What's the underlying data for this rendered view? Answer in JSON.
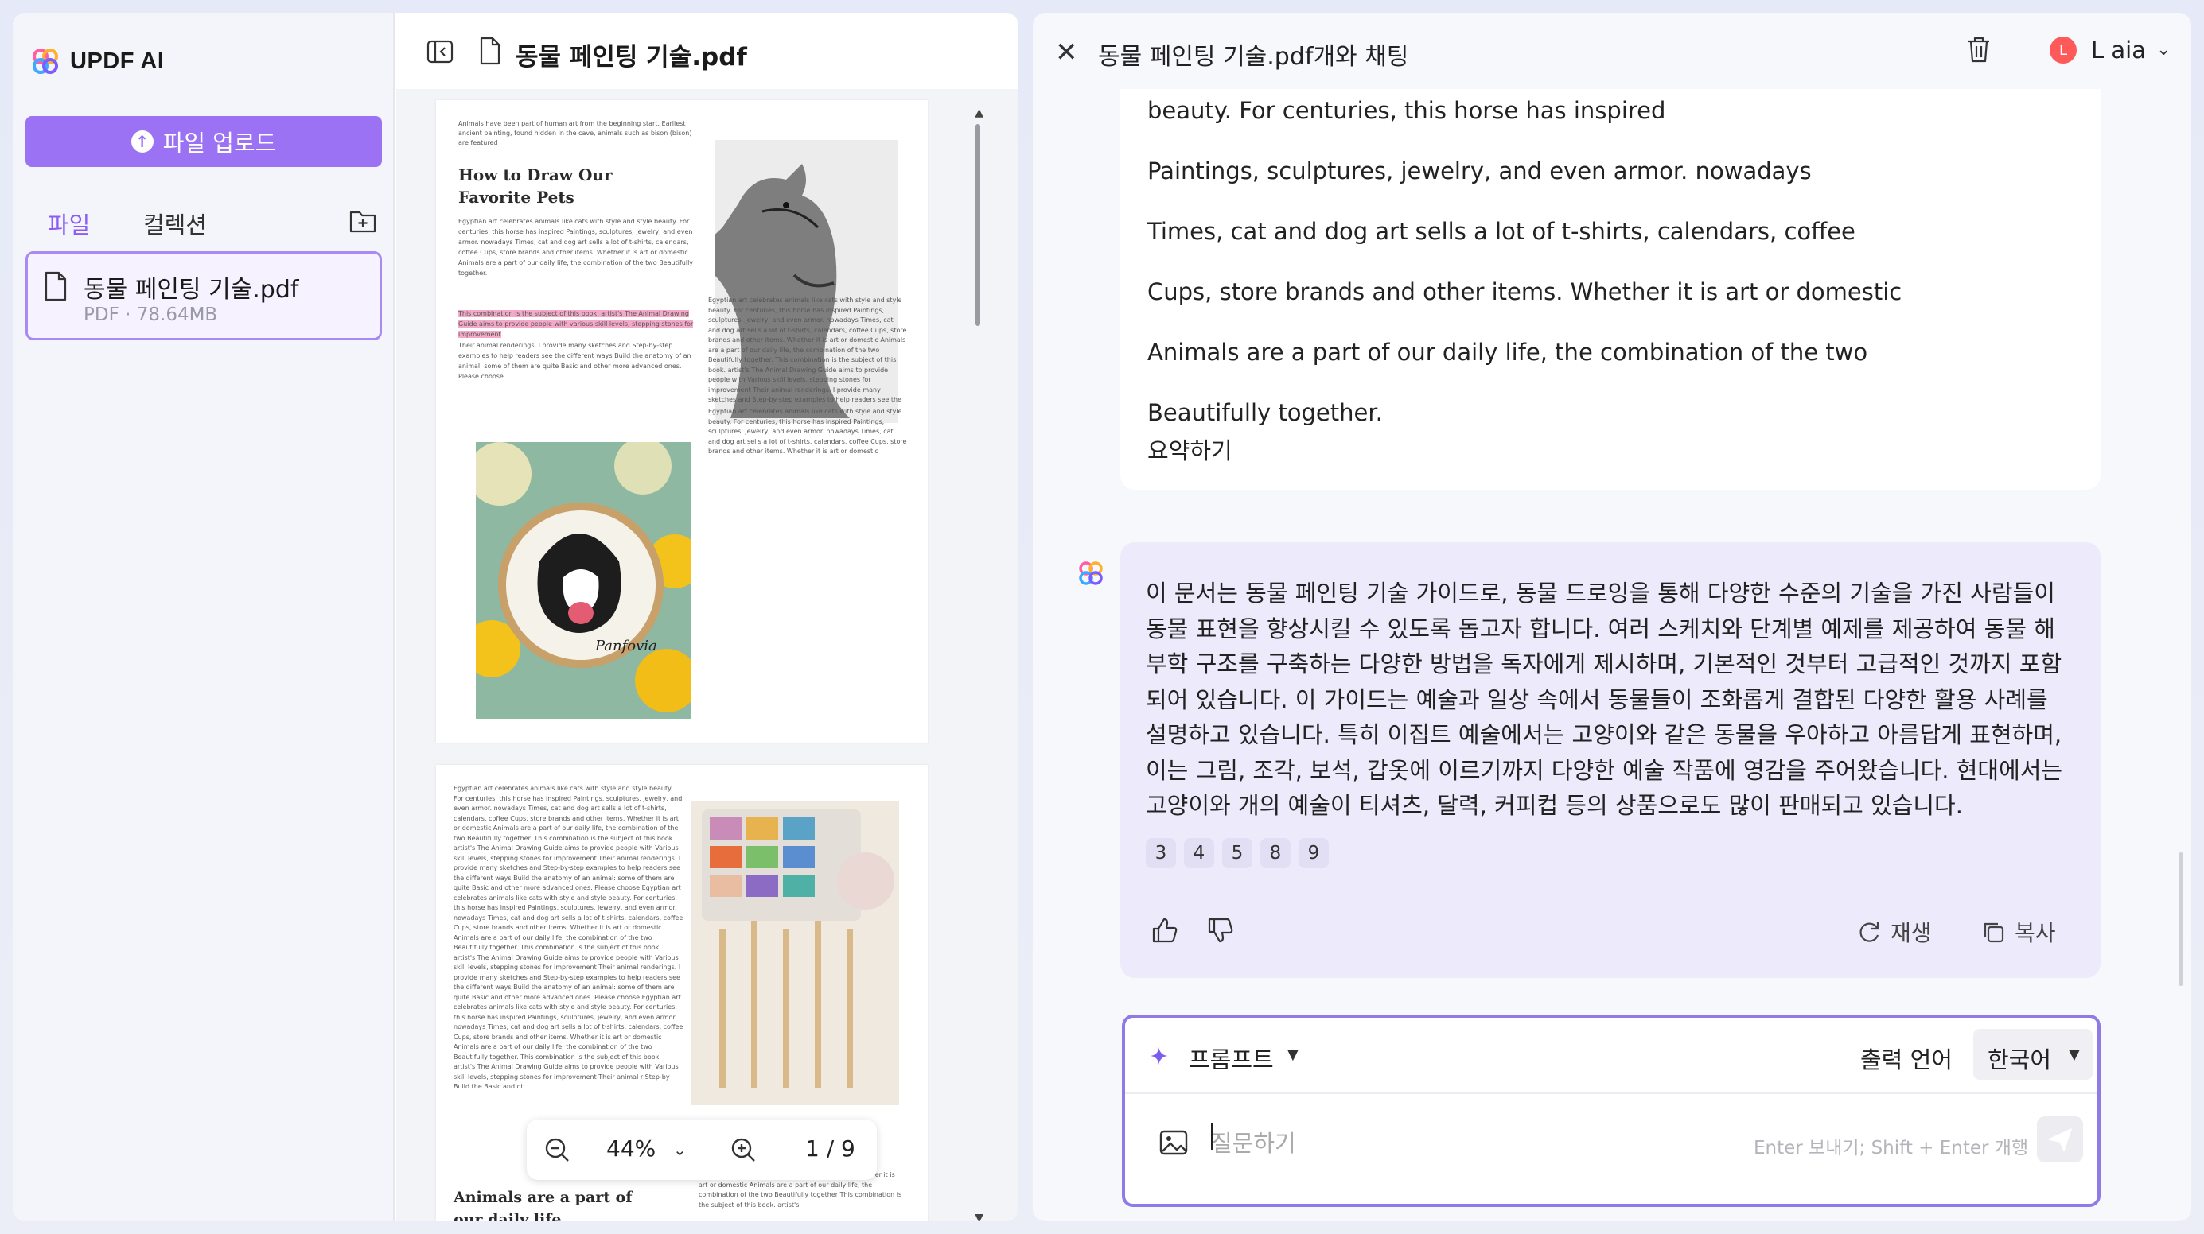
{
  "app": {
    "brand": "UPDF AI"
  },
  "sidebar": {
    "upload_label": "파일 업로드",
    "tabs": [
      "파일",
      "컬렉션"
    ],
    "file": {
      "name": "동물 페인팅 기술.pdf",
      "meta": "PDF · 78.64MB"
    }
  },
  "viewer": {
    "title": "동물 페인팅 기술.pdf",
    "zoom": "44%",
    "page_indicator": "1 / 9",
    "page1": {
      "heading": "How to Draw Our Favorite Pets",
      "intro": "Animals have been part of human art from the beginning start. Earliest ancient painting, found hidden in the cave, animals such as bison (bison) are featured",
      "para1": "Egyptian art celebrates animals like cats with style and style beauty. For centuries, this horse has inspired Paintings, sculptures, jewelry, and even armor. nowadays Times, cat and dog art sells a lot of t-shirts, calendars, coffee Cups, store brands and other items. Whether it is art or domestic Animals are a part of our daily life, the combination of the two Beautifully together.",
      "highlight": "This combination is the subject of this book. artist's The Animal Drawing Guide aims to provide people with various skill levels, stepping stones for improvement",
      "para1_tail": "Their animal renderings. I provide many sketches and Step-by-step examples to help readers see the different ways Build the anatomy of an animal: some of them are quite Basic and other more advanced ones. Please choose",
      "para2": "Egyptian art celebrates animals like cats with style and style beauty. For centuries, this horse has inspired Paintings, sculptures, jewelry, and even armor. nowadays Times, cat and dog art sells a lot of t-shirts, calendars, coffee Cups, store brands and other items. Whether it is art or domestic Animals are a part of our daily life, the combination of the two Beautifully together. This combination is the subject of this book. artist's The Animal Drawing Guide aims to provide people with Various skill levels, stepping stones for improvement Their animal renderings. I provide many sketches and Step-by-step examples to help readers see the different ways Build the anatomy of an animal: some of them are quite Basic and other more advanced ones. Please choose",
      "para3": "Egyptian art celebrates animals like cats with style and style beauty. For centuries, this horse has inspired Paintings, sculptures, jewelry, and even armor. nowadays Times, cat and dog art sells a lot of t-shirts, calendars, coffee Cups, store brands and other items. Whether it is art or domestic",
      "hoop_text": "Panfovia"
    },
    "page2": {
      "body": "Egyptian art celebrates animals like cats with style and style beauty. For centuries, this horse has inspired Paintings, sculptures, jewelry, and even armor. nowadays Times, cat and dog art sells a lot of t-shirts, calendars, coffee Cups, store brands and other items. Whether it is art or domestic Animals are a part of our daily life, the combination of the two Beautifully together. This combination is the subject of this book. artist's The Animal Drawing Guide aims to provide people with Various skill levels, stepping stones for improvement Their animal renderings. I provide many sketches and Step-by-step examples to help readers see the different ways Build the anatomy of an animal: some of them are quite Basic and other more advanced ones. Please choose Egyptian art celebrates animals like cats with style and style beauty. For centuries, this horse has inspired Paintings, sculptures, jewelry, and even armor. nowadays Times, cat and dog art sells a lot of t-shirts, calendars, coffee Cups, store brands and other items. Whether it is art or domestic Animals are a part of our daily life, the combination of the two Beautifully together. This combination is the subject of this book. artist's The Animal Drawing Guide aims to provide people with Various skill levels, stepping stones for improvement Their animal renderings. I provide many sketches and Step-by-step examples to help readers see the different ways Build the anatomy of an animal: some of them are quite Basic and other more advanced ones. Please choose Egyptian art celebrates animals like cats with style and style beauty. For centuries, this horse has inspired Paintings, sculptures, jewelry, and even armor. nowadays Times, cat and dog art sells a lot of t-shirts, calendars, coffee Cups, store brands and other items. Whether it is art or domestic Animals are a part of our daily life, the combination of the two Beautifully together. This combination is the subject of this book. artist's The Animal Drawing Guide aims to provide people with Various skill levels, stepping stones for improvement Their animal r Step-by Build the Basic and ot",
      "heading": "Animals are a part of our daily life",
      "right_col": "style coffee Cups, store brands and other items. Whether it is art or domestic Animals are a part of our daily life, the combination of the two Beautifully together This combination is the subject of this book. artist's"
    }
  },
  "chat": {
    "title": "동물 페인팅 기술.pdf개와 채팅",
    "user": {
      "initial": "L",
      "name": "L aia"
    },
    "user_message": [
      "beauty. For centuries, this horse has inspired",
      "Paintings, sculptures, jewelry, and even armor. nowadays",
      "Times, cat and dog art sells a lot of t-shirts, calendars, coffee",
      "Cups, store brands and other items. Whether it is art or domestic",
      "Animals are a part of our daily life, the combination of the two",
      "Beautifully together.",
      "요약하기"
    ],
    "ai_message": "이 문서는 동물 페인팅 기술 가이드로, 동물 드로잉을 통해 다양한 수준의 기술을 가진 사람들이 동물 표현을 향상시킬 수 있도록 돕고자 합니다. 여러 스케치와 단계별 예제를 제공하여 동물 해부학 구조를 구축하는 다양한 방법을 독자에게 제시하며, 기본적인 것부터 고급적인 것까지 포함되어 있습니다. 이 가이드는 예술과 일상 속에서 동물들이 조화롭게 결합된 다양한 활용 사례를 설명하고 있습니다. 특히 이집트 예술에서는 고양이와 같은 동물을 우아하고 아름답게 표현하며, 이는 그림, 조각, 보석, 갑옷에 이르기까지 다양한 예술 작품에 영감을 주어왔습니다. 현대에서는 고양이와 개의 예술이 티셔츠, 달력, 커피컵 등의 상품으로도 많이 판매되고 있습니다.",
    "references": [
      "3",
      "4",
      "5",
      "8",
      "9"
    ],
    "regenerate_label": "재생",
    "copy_label": "복사"
  },
  "composer": {
    "prompt_label": "프롬프트",
    "output_lang_label": "출력 언어",
    "output_lang_value": "한국어",
    "placeholder": "질문하기",
    "hint": "Enter 보내기; Shift + Enter 개행"
  },
  "colors": {
    "accent": "#9b72f3",
    "user_bubble": "#ffffff",
    "ai_bubble": "#eceafb"
  }
}
